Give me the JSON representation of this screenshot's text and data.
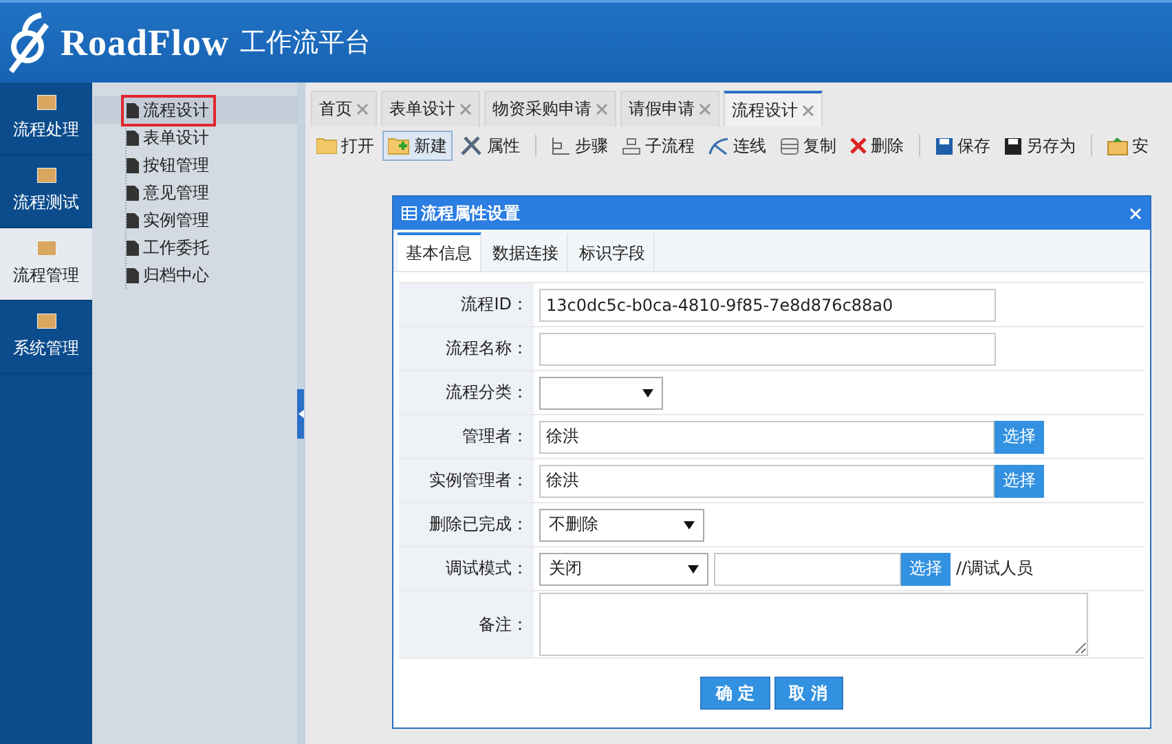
{
  "header": {
    "logo_text": "RoadFlow",
    "subtitle": "工作流平台"
  },
  "nav": [
    {
      "label": "流程处理",
      "selected": false
    },
    {
      "label": "流程测试",
      "selected": false
    },
    {
      "label": "流程管理",
      "selected": true
    },
    {
      "label": "系统管理",
      "selected": false
    }
  ],
  "tree": [
    {
      "label": "流程设计",
      "selected": true
    },
    {
      "label": "表单设计",
      "selected": false
    },
    {
      "label": "按钮管理",
      "selected": false
    },
    {
      "label": "意见管理",
      "selected": false
    },
    {
      "label": "实例管理",
      "selected": false
    },
    {
      "label": "工作委托",
      "selected": false
    },
    {
      "label": "归档中心",
      "selected": false
    }
  ],
  "tabs": [
    {
      "label": "首页",
      "selected": false
    },
    {
      "label": "表单设计",
      "selected": false
    },
    {
      "label": "物资采购申请",
      "selected": false
    },
    {
      "label": "请假申请",
      "selected": false
    },
    {
      "label": "流程设计",
      "selected": true
    }
  ],
  "toolbar": [
    {
      "kind": "button",
      "label": "打开",
      "pressed": false
    },
    {
      "kind": "button",
      "label": "新建",
      "pressed": true
    },
    {
      "kind": "button",
      "label": "属性",
      "pressed": false
    },
    {
      "kind": "separator"
    },
    {
      "kind": "button",
      "label": "步骤",
      "pressed": false
    },
    {
      "kind": "button",
      "label": "子流程",
      "pressed": false
    },
    {
      "kind": "button",
      "label": "连线",
      "pressed": false
    },
    {
      "kind": "button",
      "label": "复制",
      "pressed": false
    },
    {
      "kind": "button",
      "label": "删除",
      "pressed": false
    },
    {
      "kind": "separator"
    },
    {
      "kind": "button",
      "label": "保存",
      "pressed": false
    },
    {
      "kind": "button",
      "label": "另存为",
      "pressed": false
    },
    {
      "kind": "separator"
    },
    {
      "kind": "button",
      "label": "安",
      "pressed": false
    }
  ],
  "dialog": {
    "title": "流程属性设置",
    "tabs": [
      {
        "label": "基本信息",
        "selected": true
      },
      {
        "label": "数据连接",
        "selected": false
      },
      {
        "label": "标识字段",
        "selected": false
      }
    ],
    "fields": [
      {
        "kind": "text",
        "label": "流程ID：",
        "value": "13c0dc5c-b0ca-4810-9f85-7e8d876c88a0"
      },
      {
        "kind": "text",
        "label": "流程名称："
      },
      {
        "kind": "short-select",
        "label": "流程分类："
      },
      {
        "kind": "picker",
        "label": "管理者：",
        "value": "徐洪",
        "button": "选择"
      },
      {
        "kind": "picker",
        "label": "实例管理者：",
        "value": "徐洪",
        "button": "选择"
      },
      {
        "kind": "select",
        "label": "删除已完成：",
        "value": "不删除"
      },
      {
        "kind": "select-picker",
        "label": "调试模式：",
        "value": "关闭",
        "button": "选择",
        "note": "//调试人员"
      },
      {
        "kind": "textarea",
        "label": "备注："
      }
    ],
    "buttons": [
      "确 定",
      "取 消"
    ]
  }
}
